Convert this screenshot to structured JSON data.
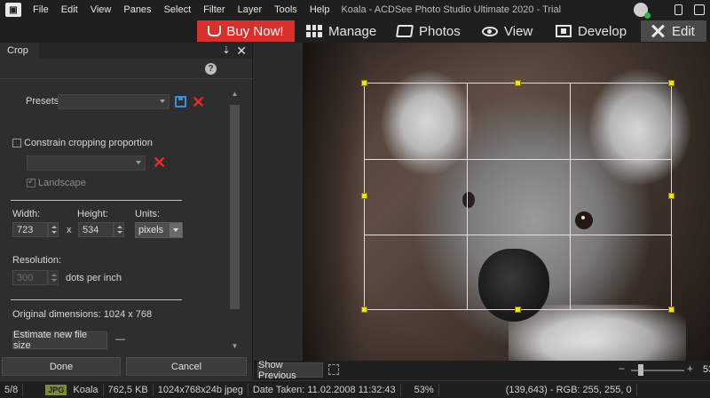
{
  "menu": {
    "items": [
      "File",
      "Edit",
      "View",
      "Panes",
      "Select",
      "Filter",
      "Layer",
      "Tools",
      "Help"
    ],
    "title": "Koala - ACDSee Photo Studio Ultimate 2020 - Trial"
  },
  "modes": {
    "buy_now": "Buy Now!",
    "manage": "Manage",
    "photos": "Photos",
    "view": "View",
    "develop": "Develop",
    "edit": "Edit",
    "active": "Edit"
  },
  "panel": {
    "tab": "Crop",
    "pin_glyph": "⇣",
    "close_glyph": "✕",
    "help_glyph": "?",
    "presets_label": "Presets",
    "presets_value": "",
    "constrain_label": "Constrain cropping proportion",
    "landscape_label": "Landscape",
    "width_label": "Width:",
    "height_label": "Height:",
    "units_label": "Units:",
    "width_value": "723",
    "height_value": "534",
    "times": "x",
    "units_value": "pixels",
    "resolution_label": "Resolution:",
    "resolution_value": "300",
    "dpi_label": "dots per inch",
    "original_dimensions": "Original dimensions: 1024 x 768",
    "estimate_button": "Estimate new file size",
    "estimate_value": "—",
    "done_button": "Done",
    "cancel_button": "Cancel"
  },
  "canvas": {
    "show_previous": "Show Previous",
    "zoom_value": "53"
  },
  "status": {
    "index": "5/8",
    "file_type": "JPG",
    "name": "Koala",
    "size": "762,5 KB",
    "dims": "1024x768x24b jpeg",
    "date_taken": "Date Taken: 11.02.2008 11:32:43",
    "zoom": "53%",
    "pixel_info": "(139,643) - RGB: 255, 255, 0"
  },
  "colors": {
    "buy_now_bg": "#d9302b",
    "crop_handle": "#f3e21a",
    "save_icon": "#3d8fd6",
    "delete_icon": "#d9302b"
  }
}
